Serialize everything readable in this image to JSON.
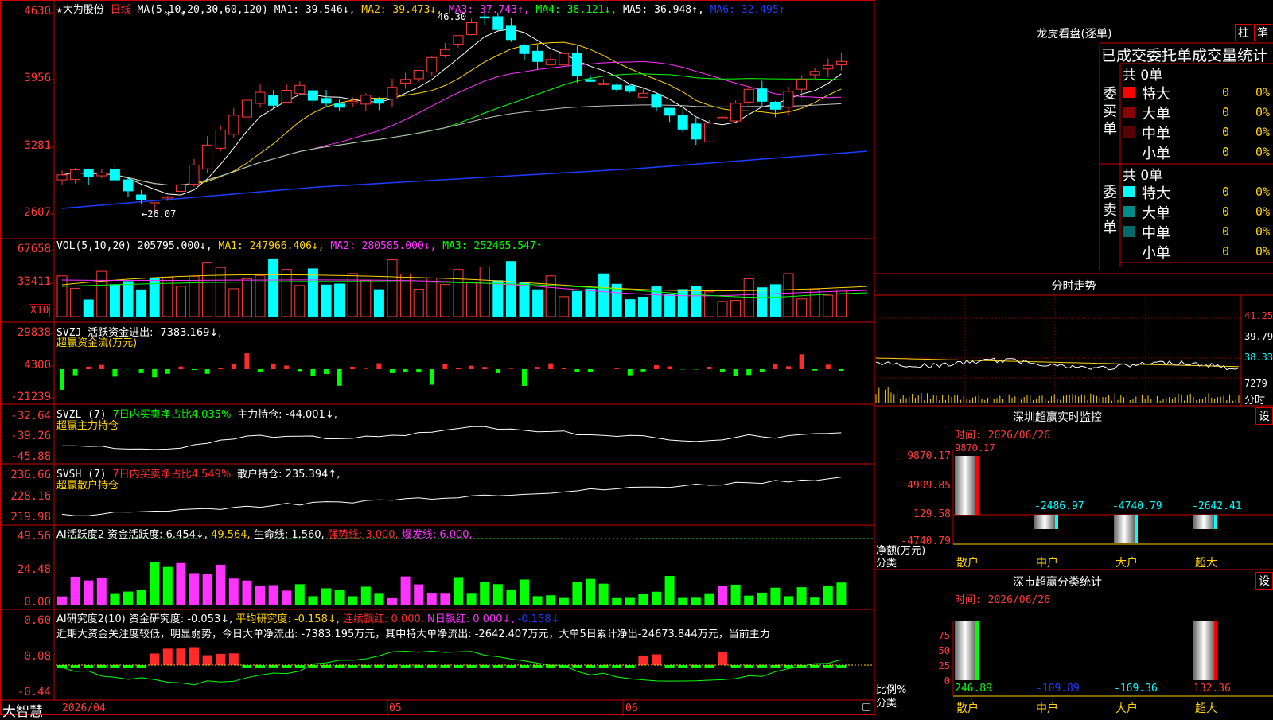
{
  "app": {
    "brand": "大智慧"
  },
  "main_chart": {
    "name_star": "★",
    "stock_name": "大为股份",
    "period": "日线",
    "ma_label": "MA(5,10,20,30,60,120)",
    "ma1": "MA1: 39.546↓,",
    "ma2": "MA2: 39.473↓,",
    "ma3": "MA3: 37.743↑,",
    "ma4": "MA4: 38.121↓,",
    "ma5": "MA5: 36.948↑,",
    "ma6": "MA6: 32.495↑",
    "ylabels": [
      "4630",
      "3956",
      "3281",
      "2607"
    ],
    "high_note": "46.30",
    "low_note": "←26.07",
    "markers": "* *"
  },
  "vol_chart": {
    "label": "VOL(5,10,20)",
    "value": "205795.000↓,",
    "ma1": "MA1: 247966.406↓,",
    "ma2": "MA2: 280585.000↓,",
    "ma3": "MA3: 252465.547↑",
    "ylabels": [
      "67658",
      "33411"
    ],
    "unit": "X10"
  },
  "svzj": {
    "label": "SVZJ",
    "desc": "活跃资金进出: -7383.169↓,",
    "sub": "超赢资金流(万元)",
    "ylabels": [
      "29838",
      "4300",
      "-21239"
    ]
  },
  "svzl": {
    "label": "SVZL (7)",
    "desc": "7日内买卖净占比4.035%",
    "desc2": "主力持仓: -44.001↓,",
    "sub": "超赢主力持仓",
    "ylabels": [
      "-32.64",
      "-39.26",
      "-45.88"
    ]
  },
  "svsh": {
    "label": "SVSH (7)",
    "desc": "7日内买卖净占比4.549%",
    "desc2": "散户持仓: 235.394↑,",
    "sub": "超赢散户持仓",
    "ylabels": [
      "236.66",
      "228.16",
      "219.98"
    ]
  },
  "ai_active": {
    "label": "AI活跃度2",
    "v1": "资金活跃度: 6.454↓,",
    "v2": "49.564,",
    "v3": "生命线: 1.560,",
    "v4": "强势线: 3.000,",
    "v5": "爆发线: 6.000,",
    "ylabels": [
      "49.56",
      "24.48",
      "0.00"
    ]
  },
  "ai_research": {
    "label": "AI研究度2(10)",
    "v1": "资金研究度: -0.053↓,",
    "v2": "平均研究度: -0.158↓,",
    "v3": "连续飘红: 0.000,",
    "v4": "N日飘红: 0.000↓,",
    "v5": "-0.158↓",
    "text": "近期大资金关注度较低，明显弱势，今日大单净流出: -7383.195万元，其中特大单净流出: -2642.407万元，大单5日累计净出-24673.844万元，当前主力",
    "ylabels": [
      "0.60",
      "0.08",
      "-0.44"
    ]
  },
  "dates": [
    "2026/04",
    "05",
    "06"
  ],
  "longhu": {
    "title": "龙虎看盘(逐单)",
    "btn1": "柱",
    "btn2": "笔",
    "header": "已成交委托单成交量统计",
    "buy_label": "委买单",
    "sell_label": "委卖单",
    "buy_total": "共 0单",
    "sell_total": "共 0单",
    "buy_rows": [
      {
        "name": "特大",
        "count": "0",
        "pct": "0%",
        "color": "#ff0000"
      },
      {
        "name": "大单",
        "count": "0",
        "pct": "0%",
        "color": "#8b0000"
      },
      {
        "name": "中单",
        "count": "0",
        "pct": "0%",
        "color": "#5a0000"
      },
      {
        "name": "小单",
        "count": "0",
        "pct": "0%",
        "color": "#000000"
      }
    ],
    "sell_rows": [
      {
        "name": "特大",
        "count": "0",
        "pct": "0%",
        "color": "#00ffff"
      },
      {
        "name": "大单",
        "count": "0",
        "pct": "0%",
        "color": "#008b8b"
      },
      {
        "name": "中单",
        "count": "0",
        "pct": "0%",
        "color": "#006a6a"
      },
      {
        "name": "小单",
        "count": "0",
        "pct": "0%",
        "color": "#000000"
      }
    ]
  },
  "intraday": {
    "title": "分时走势",
    "ylabels": [
      "41.25",
      "39.79",
      "38.33",
      "7279"
    ],
    "foot": "分时"
  },
  "monitor": {
    "title": "深圳超赢实时监控",
    "btn": "设",
    "time": "时间: 2026/06/26",
    "ylabels": [
      "9870.17",
      "4999.85",
      "129.58",
      "-4740.79"
    ],
    "top_label": "9870.17",
    "values": [
      "-2486.97",
      "-4740.79",
      "-2642.41"
    ],
    "ylabel_unit": "净额(万元)",
    "xcat": "分类",
    "cats": [
      "散户",
      "中户",
      "大户",
      "超大"
    ]
  },
  "classify": {
    "title": "深市超赢分类统计",
    "btn": "设",
    "time": "时间: 2026/06/26",
    "ylabels": [
      "75",
      "50",
      "25",
      "0"
    ],
    "values": [
      "246.89",
      "-109.89",
      "-169.36",
      "132.36"
    ],
    "ylabel_unit": "比例%",
    "xcat": "分类",
    "cats": [
      "散户",
      "中户",
      "大户",
      "超大"
    ]
  }
}
